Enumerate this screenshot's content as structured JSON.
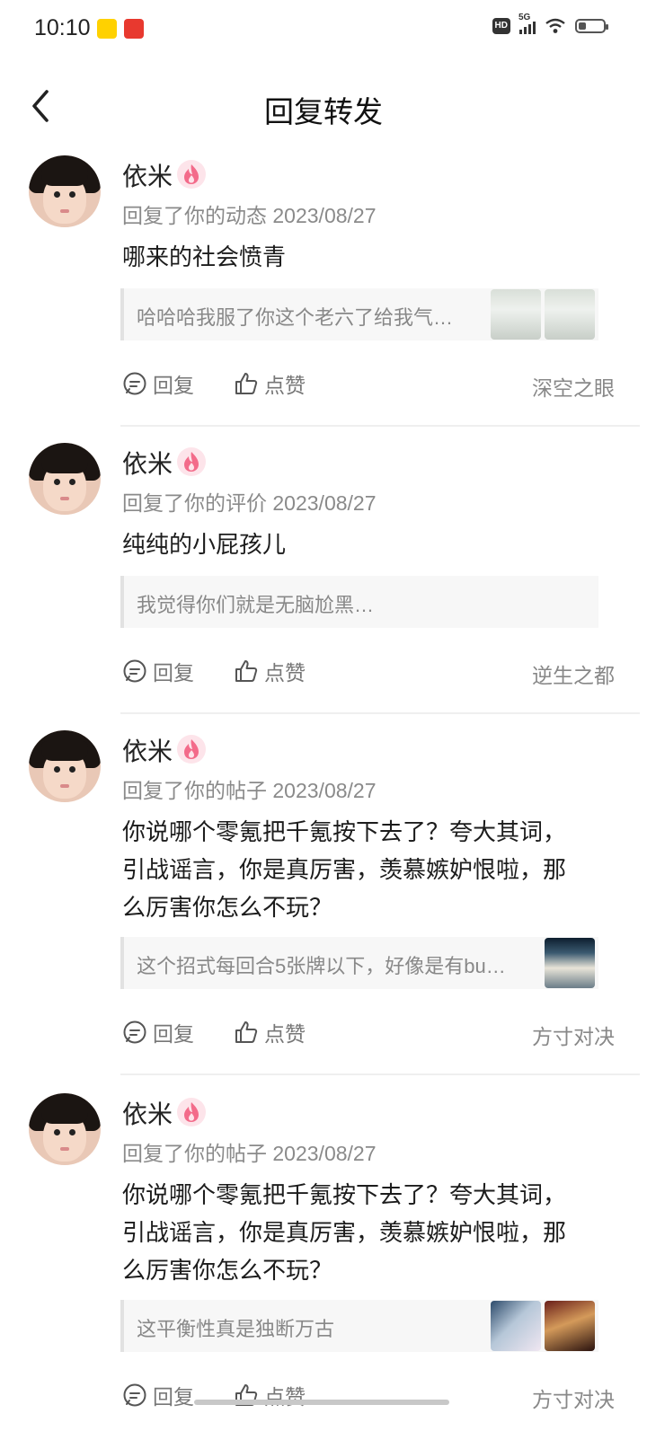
{
  "status": {
    "time": "10:10",
    "network": "5G",
    "hd": "HD",
    "battery_level": 0.3
  },
  "header": {
    "title": "回复转发"
  },
  "items": [
    {
      "user": "依米",
      "meta": "回复了你的动态 2023/08/27",
      "content": [
        "哪来的社会愤青"
      ],
      "quote": "哈哈哈我服了你这个老六了给我气…",
      "thumbs": 2,
      "reply": "回复",
      "like": "点赞",
      "source": "深空之眼"
    },
    {
      "user": "依米",
      "meta": "回复了你的评价 2023/08/27",
      "content": [
        "纯纯的小屁孩儿"
      ],
      "quote": "我觉得你们就是无脑尬黑…",
      "thumbs": 0,
      "reply": "回复",
      "like": "点赞",
      "source": "逆生之都"
    },
    {
      "user": "依米",
      "meta": "回复了你的帖子 2023/08/27",
      "content": [
        "你说哪个零氪把千氪按下去了？夸大其词，",
        "引战谣言，你是真厉害，羡慕嫉妒恨啦，那",
        "么厉害你怎么不玩？"
      ],
      "quote": "这个招式每回合5张牌以下，好像是有bu…",
      "thumbs": 1,
      "reply": "回复",
      "like": "点赞",
      "source": "方寸对决"
    },
    {
      "user": "依米",
      "meta": "回复了你的帖子 2023/08/27",
      "content": [
        "你说哪个零氪把千氪按下去了？夸大其词，",
        "引战谣言，你是真厉害，羡慕嫉妒恨啦，那",
        "么厉害你怎么不玩？"
      ],
      "quote": "这平衡性真是独断万古",
      "thumbs": 2,
      "reply": "回复",
      "like": "点赞",
      "source": "方寸对决"
    }
  ],
  "colors": {
    "badge_pink": "#f36b8a",
    "text_muted": "#8a8a8a"
  }
}
